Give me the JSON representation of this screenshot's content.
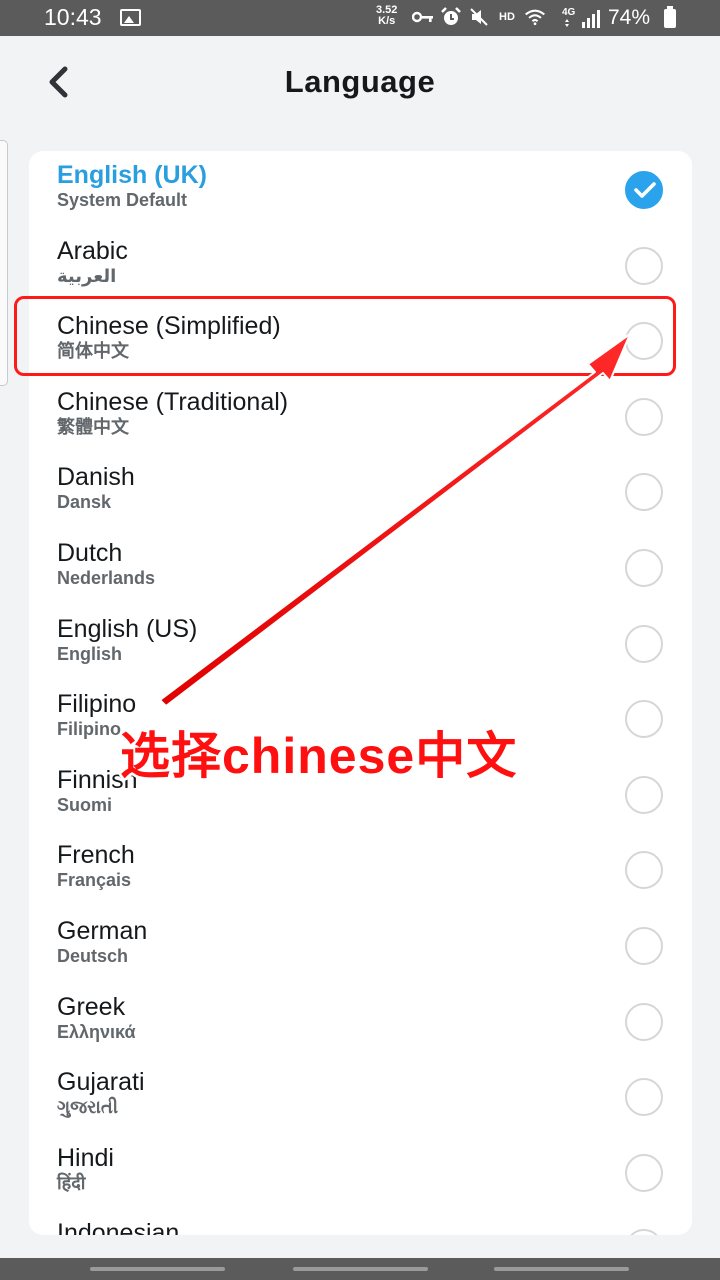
{
  "status_bar": {
    "time": "10:43",
    "net_speed_value": "3.52",
    "net_speed_unit": "K/s",
    "hd_label": "HD",
    "network_label": "4G",
    "battery": "74%"
  },
  "header": {
    "title": "Language"
  },
  "languages": [
    {
      "name": "English (UK)",
      "native": "System Default",
      "selected": true
    },
    {
      "name": "Arabic",
      "native": "العربية",
      "selected": false
    },
    {
      "name": "Chinese (Simplified)",
      "native": "简体中文",
      "selected": false
    },
    {
      "name": "Chinese (Traditional)",
      "native": "繁體中文",
      "selected": false
    },
    {
      "name": "Danish",
      "native": "Dansk",
      "selected": false
    },
    {
      "name": "Dutch",
      "native": "Nederlands",
      "selected": false
    },
    {
      "name": "English (US)",
      "native": "English",
      "selected": false
    },
    {
      "name": "Filipino",
      "native": "Filipino",
      "selected": false
    },
    {
      "name": "Finnish",
      "native": "Suomi",
      "selected": false
    },
    {
      "name": "French",
      "native": "Français",
      "selected": false
    },
    {
      "name": "German",
      "native": "Deutsch",
      "selected": false
    },
    {
      "name": "Greek",
      "native": "Ελληνικά",
      "selected": false
    },
    {
      "name": "Gujarati",
      "native": "ગુજરાતી",
      "selected": false
    },
    {
      "name": "Hindi",
      "native": "हिंदी",
      "selected": false
    },
    {
      "name": "Indonesian",
      "native": "",
      "selected": false
    }
  ],
  "annotation": {
    "caption": "选择chinese中文",
    "color": "#ff1a1a"
  },
  "colors": {
    "accent": "#2ba3ec",
    "selected_text": "#2a9fe0"
  }
}
